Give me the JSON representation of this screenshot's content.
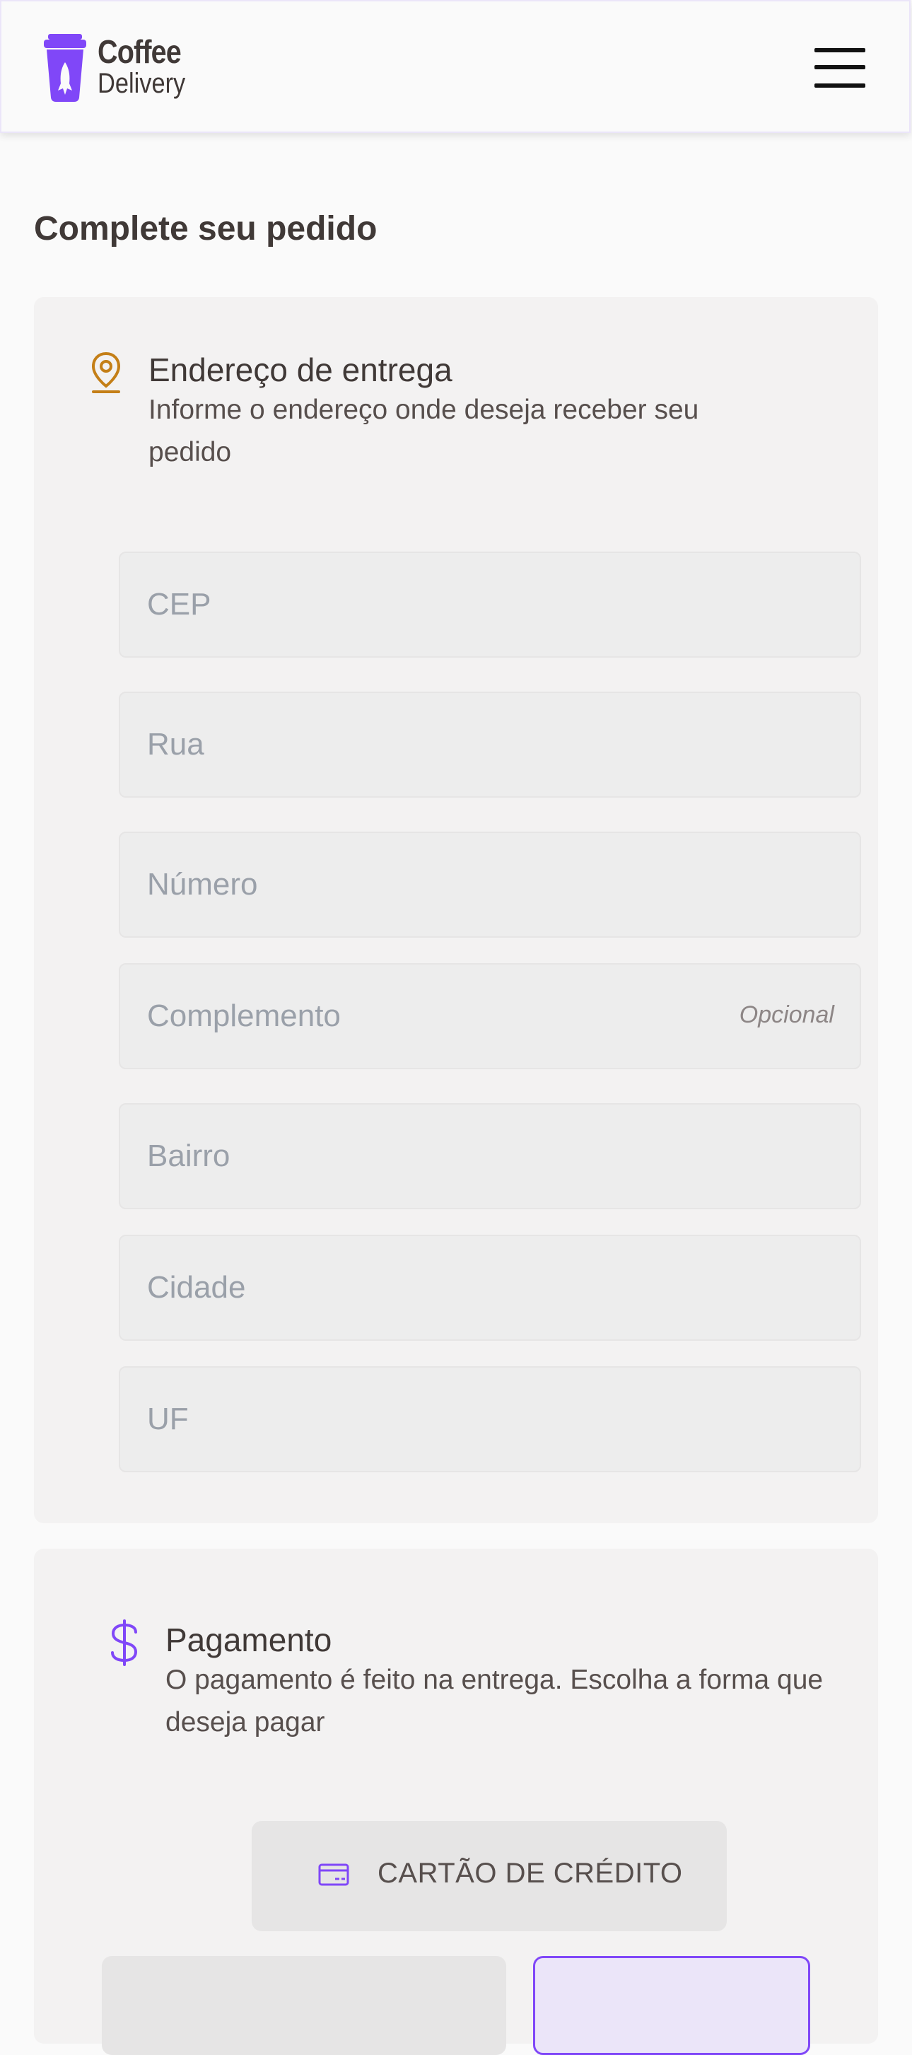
{
  "header": {
    "logo_line1": "Coffee",
    "logo_line2": "Delivery",
    "menu_icon": "hamburger-menu-icon"
  },
  "page_title": "Complete seu pedido",
  "address": {
    "icon": "map-pin-icon",
    "title": "Endereço de entrega",
    "subtitle": "Informe o endereço onde deseja receber seu pedido",
    "fields": {
      "cep": "CEP",
      "rua": "Rua",
      "numero": "Número",
      "complemento": "Complemento",
      "complemento_optional": "Opcional",
      "bairro": "Bairro",
      "cidade": "Cidade",
      "uf": "UF"
    }
  },
  "payment": {
    "icon": "currency-dollar-icon",
    "title": "Pagamento",
    "subtitle": "O pagamento é feito na entrega. Escolha a forma que deseja pagar",
    "credit_card_label": "CARTÃO DE CRÉDITO",
    "credit_card_icon": "credit-card-icon"
  },
  "colors": {
    "brand_purple": "#8047f8",
    "brand_yellow": "#c47f17",
    "base_text": "#403937",
    "card_bg": "#f3f2f2",
    "input_bg": "#ededed"
  }
}
